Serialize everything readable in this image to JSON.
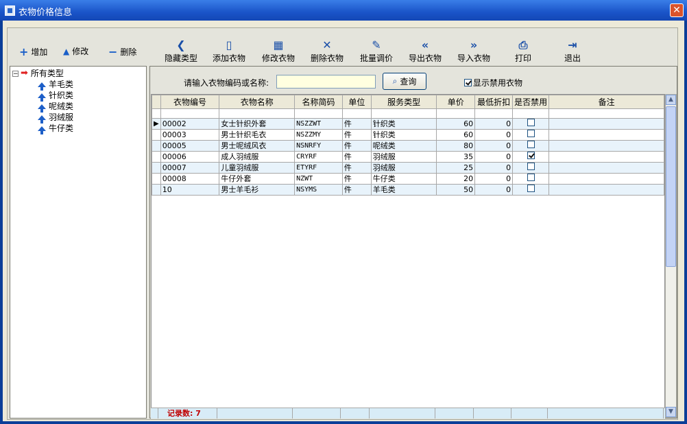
{
  "window": {
    "title": "衣物价格信息",
    "close": "✕"
  },
  "left_toolbar": [
    {
      "label": "增加",
      "icon": "plus-icon"
    },
    {
      "label": "修改",
      "icon": "triangle-up-icon"
    },
    {
      "label": "删除",
      "icon": "minus-icon"
    }
  ],
  "toolbar": [
    {
      "label": "隐藏类型",
      "icon": "chevron-left-icon",
      "glyph": "❮"
    },
    {
      "label": "添加衣物",
      "icon": "new-document-icon",
      "glyph": "▯"
    },
    {
      "label": "修改衣物",
      "icon": "clipboard-icon",
      "glyph": "▦"
    },
    {
      "label": "删除衣物",
      "icon": "x-icon",
      "glyph": "✕"
    },
    {
      "label": "批量调价",
      "icon": "pen-icon",
      "glyph": "✎"
    },
    {
      "label": "导出衣物",
      "icon": "double-chevron-left-icon",
      "glyph": "«"
    },
    {
      "label": "导入衣物",
      "icon": "double-chevron-right-icon",
      "glyph": "»"
    },
    {
      "label": "打印",
      "icon": "printer-icon",
      "glyph": "⎙"
    },
    {
      "label": "退出",
      "icon": "exit-door-icon",
      "glyph": "⇥"
    }
  ],
  "tree": {
    "root": "所有类型",
    "children": [
      "羊毛类",
      "针织类",
      "呢绒类",
      "羽绒服",
      "牛仔类"
    ]
  },
  "search": {
    "label": "请输入衣物编码或名称:",
    "value": "",
    "button": "查询",
    "show_disabled_label": "显示禁用衣物",
    "show_disabled": true
  },
  "table": {
    "columns": [
      "衣物编号",
      "衣物名称",
      "名称简码",
      "单位",
      "服务类型",
      "单价",
      "最低折扣",
      "是否禁用",
      "备注"
    ],
    "rows": [
      {
        "code": "00002",
        "name": "女士针织外套",
        "abbr": "NSZZWT",
        "unit": "件",
        "type": "针织类",
        "price": "60",
        "discount": "0",
        "disabled": false,
        "note": ""
      },
      {
        "code": "00003",
        "name": "男士针织毛衣",
        "abbr": "NSZZMY",
        "unit": "件",
        "type": "针织类",
        "price": "60",
        "discount": "0",
        "disabled": false,
        "note": ""
      },
      {
        "code": "00005",
        "name": "男士呢绒风衣",
        "abbr": "NSNRFY",
        "unit": "件",
        "type": "呢绒类",
        "price": "80",
        "discount": "0",
        "disabled": false,
        "note": ""
      },
      {
        "code": "00006",
        "name": "成人羽绒服",
        "abbr": "CRYRF",
        "unit": "件",
        "type": "羽绒服",
        "price": "35",
        "discount": "0",
        "disabled": true,
        "note": ""
      },
      {
        "code": "00007",
        "name": "儿童羽绒服",
        "abbr": "ETYRF",
        "unit": "件",
        "type": "羽绒服",
        "price": "25",
        "discount": "0",
        "disabled": false,
        "note": ""
      },
      {
        "code": "00008",
        "name": "牛仔外套",
        "abbr": "NZWT",
        "unit": "件",
        "type": "牛仔类",
        "price": "20",
        "discount": "0",
        "disabled": false,
        "note": ""
      },
      {
        "code": "10",
        "name": "男士羊毛衫",
        "abbr": "NSYMS",
        "unit": "件",
        "type": "羊毛类",
        "price": "50",
        "discount": "0",
        "disabled": false,
        "note": ""
      }
    ]
  },
  "footer": {
    "record_count": "记录数: 7"
  },
  "colors": {
    "titlebar": "#1a54c8",
    "row_alt": "#e8f3fb",
    "search_bg": "#ffffe0",
    "count_text": "#c00000"
  }
}
